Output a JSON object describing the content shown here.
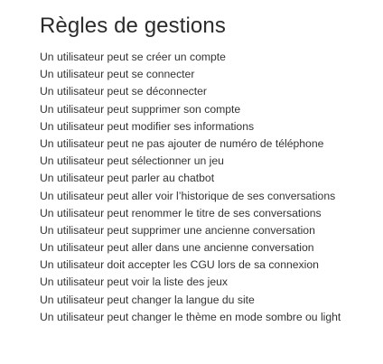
{
  "page": {
    "title": "Règles de gestions",
    "rules": [
      "Un utilisateur peut se créer un compte",
      "Un utilisateur peut se connecter",
      "Un utilisateur peut se déconnecter",
      "Un utilisateur peut supprimer son compte",
      "Un utilisateur peut modifier ses informations",
      "Un utilisateur peut ne pas ajouter de numéro de téléphone",
      "Un utilisateur peut sélectionner un jeu",
      "Un utilisateur peut parler au chatbot",
      "Un utilisateur peut aller voir l’historique de ses conversations",
      "Un utilisateur peut renommer le titre de ses conversations",
      "Un utilisateur peut supprimer une ancienne conversation",
      "Un utilisateur peut aller dans une ancienne conversation",
      "Un utilisateur doit accepter les CGU lors de sa connexion",
      "Un utilisateur peut voir la liste des jeux",
      "Un utilisateur peut changer la langue du site",
      "Un utilisateur peut changer le thème en mode sombre ou light"
    ]
  },
  "colors": {
    "background": "#ffffff",
    "title_text": "#2b2b2b",
    "body_text": "#333333"
  }
}
